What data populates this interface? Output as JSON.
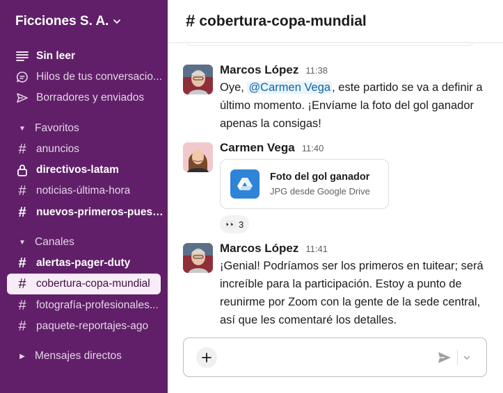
{
  "workspace": {
    "name": "Ficciones S. A."
  },
  "sidebar": {
    "top_items": [
      {
        "label": "Sin leer",
        "icon": "unread-icon",
        "bold": true
      },
      {
        "label": "Hilos de tus conversacio...",
        "icon": "threads-icon",
        "bold": false
      },
      {
        "label": "Borradores y enviados",
        "icon": "send-icon",
        "bold": false
      }
    ],
    "favorites": {
      "label": "Favoritos",
      "channels": [
        {
          "label": "anuncios",
          "icon": "hash-icon",
          "bold": false
        },
        {
          "label": "directivos-latam",
          "icon": "lock-icon",
          "bold": true
        },
        {
          "label": "noticias-última-hora",
          "icon": "hash-icon",
          "bold": false
        },
        {
          "label": "nuevos-primeros-puestos",
          "icon": "hash-icon",
          "bold": true
        }
      ]
    },
    "channels_section": {
      "label": "Canales",
      "channels": [
        {
          "label": "alertas-pager-duty",
          "icon": "hash-icon",
          "bold": true
        },
        {
          "label": "cobertura-copa-mundial",
          "icon": "hash-icon",
          "bold": false,
          "selected": true
        },
        {
          "label": "fotografía-profesionales...",
          "icon": "hash-icon",
          "bold": false
        },
        {
          "label": "paquete-reportajes-ago",
          "icon": "hash-icon",
          "bold": false
        }
      ]
    },
    "dm_section": {
      "label": "Mensajes directos"
    }
  },
  "channel": {
    "hash": "#",
    "name": "cobertura-copa-mundial"
  },
  "messages": [
    {
      "author": "Marcos López",
      "time": "11:38",
      "text_before": "Oye, ",
      "mention": "@Carmen Vega",
      "text_after": ", este partido se va a definir a último momento. ¡Envíame la foto del gol ganador apenas la consigas!"
    },
    {
      "author": "Carmen Vega",
      "time": "11:40",
      "file": {
        "name": "Foto del gol ganador",
        "subtitle": "JPG desde Google Drive",
        "icon": "google-drive-icon"
      },
      "reaction": {
        "emoji": "👀",
        "count": "3"
      }
    },
    {
      "author": "Marcos López",
      "time": "11:41",
      "text": "¡Genial! Podríamos ser los primeros en tuitear; será increíble para la participación. Estoy a punto de reunirme por Zoom con la gente de la sede central, así que les comentaré los detalles."
    }
  ],
  "composer": {
    "placeholder": ""
  },
  "colors": {
    "sidebar": "#611f69",
    "selected": "#f8ecf8",
    "mention": "#1264a3",
    "drive": "#2f84d8"
  }
}
